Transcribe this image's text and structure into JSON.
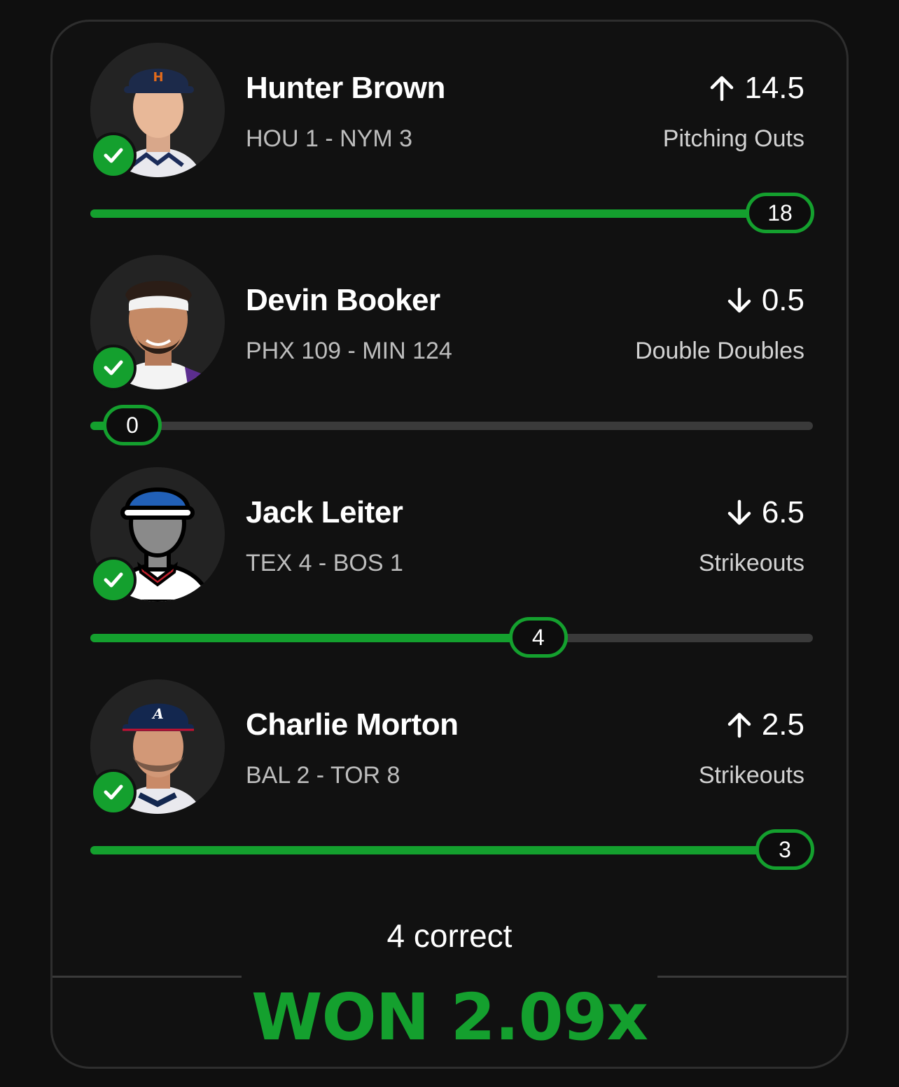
{
  "colors": {
    "accent": "#14a02e",
    "track": "#3a3a3a",
    "background": "#111111"
  },
  "picks": [
    {
      "name": "Hunter Brown",
      "score": "HOU 1  - NYM 3",
      "direction": "up",
      "line": "14.5",
      "stat": "Pitching Outs",
      "result": "18",
      "progress": 1.0,
      "status": "correct",
      "avatar": "astros-player-photo"
    },
    {
      "name": "Devin Booker",
      "score": "PHX 109  - MIN 124",
      "direction": "down",
      "line": "0.5",
      "stat": "Double Doubles",
      "result": "0",
      "progress": 0.0,
      "status": "correct",
      "avatar": "suns-player-photo"
    },
    {
      "name": "Jack Leiter",
      "score": "TEX 4  - BOS 1",
      "direction": "down",
      "line": "6.5",
      "stat": "Strikeouts",
      "result": "4",
      "progress": 0.62,
      "status": "correct",
      "avatar": "silhouette-placeholder"
    },
    {
      "name": "Charlie Morton",
      "score": "BAL 2  - TOR 8",
      "direction": "up",
      "line": "2.5",
      "stat": "Strikeouts",
      "result": "3",
      "progress": 1.0,
      "status": "correct",
      "avatar": "braves-player-photo"
    }
  ],
  "summary": {
    "correct_text": "4 correct",
    "won_text": "WON 2.09x"
  }
}
